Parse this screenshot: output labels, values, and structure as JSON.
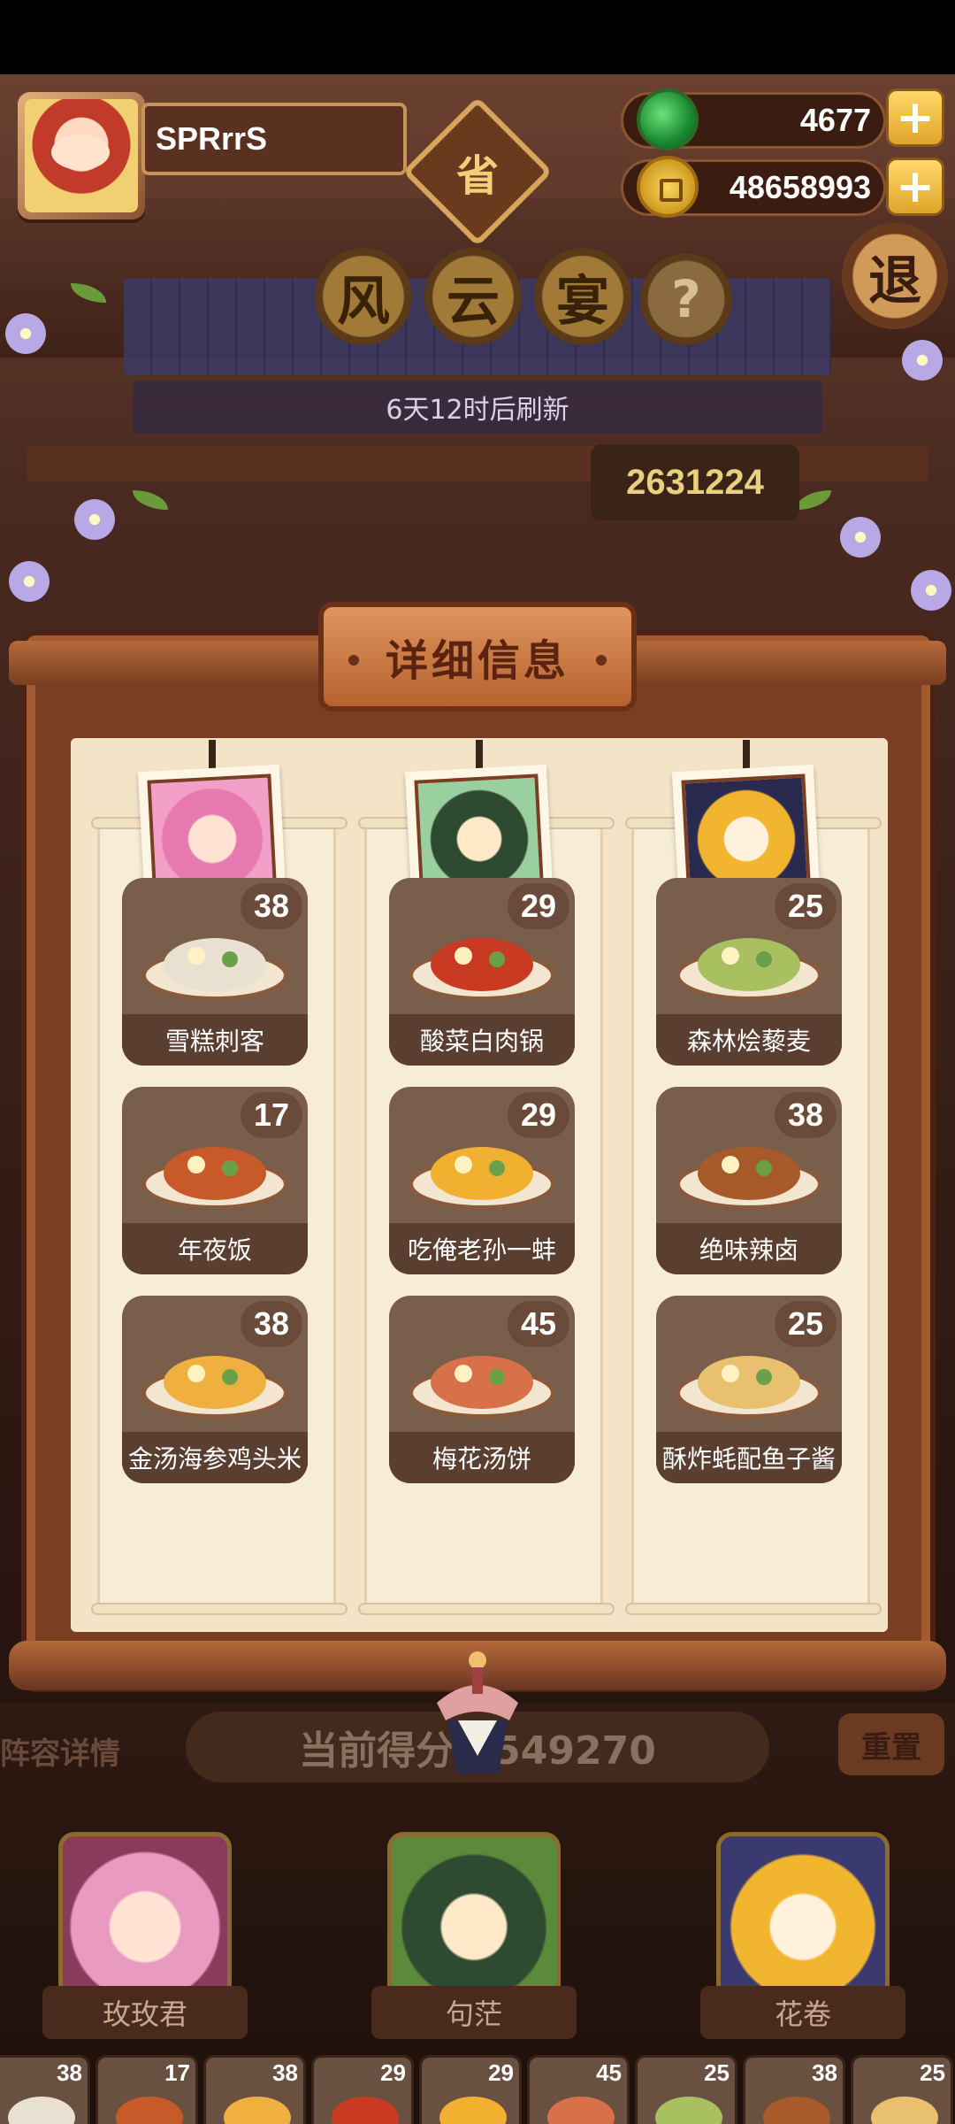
{
  "player": {
    "name": "SPRrrS"
  },
  "province_badge": "省",
  "currency": {
    "jade": "4677",
    "coins": "48658993",
    "add_symbol": "+"
  },
  "event_title": [
    "风",
    "云",
    "宴"
  ],
  "help_symbol": "?",
  "exit_label": "退",
  "refresh_text": "6天12时后刷新",
  "top_score": "2631224",
  "panel_title": "详细信息",
  "columns": [
    {
      "chef": "玫玫君",
      "dishes": [
        {
          "name": "雪糕刺客",
          "level": "38",
          "color": "#e8e0d0"
        },
        {
          "name": "年夜饭",
          "level": "17",
          "color": "#c85a2a"
        },
        {
          "name": "金汤海参鸡头米",
          "level": "38",
          "color": "#f0b040"
        }
      ]
    },
    {
      "chef": "句茫",
      "dishes": [
        {
          "name": "酸菜白肉锅",
          "level": "29",
          "color": "#c83a22"
        },
        {
          "name": "吃俺老孙一蚌",
          "level": "29",
          "color": "#f2b030"
        },
        {
          "name": "梅花汤饼",
          "level": "45",
          "color": "#d8704a"
        }
      ]
    },
    {
      "chef": "花卷",
      "dishes": [
        {
          "name": "森林烩藜麦",
          "level": "25",
          "color": "#a8c060"
        },
        {
          "name": "绝味辣卤",
          "level": "38",
          "color": "#a85a2a"
        },
        {
          "name": "酥炸蚝配鱼子酱",
          "level": "25",
          "color": "#e8c070"
        }
      ]
    }
  ],
  "bottom": {
    "lineup_label": "阵容详情",
    "current_score": "当前得分：549270",
    "reset_label": "重置"
  },
  "chefs": [
    "玫玫君",
    "句茫",
    "花卷"
  ],
  "tray": [
    {
      "level": "38",
      "color": "#e8e0d0"
    },
    {
      "level": "17",
      "color": "#c85a2a"
    },
    {
      "level": "38",
      "color": "#f0b040"
    },
    {
      "level": "29",
      "color": "#c83a22"
    },
    {
      "level": "29",
      "color": "#f2b030"
    },
    {
      "level": "45",
      "color": "#d8704a"
    },
    {
      "level": "25",
      "color": "#a8c060"
    },
    {
      "level": "38",
      "color": "#a85a2a"
    },
    {
      "level": "25",
      "color": "#e8c070"
    }
  ]
}
